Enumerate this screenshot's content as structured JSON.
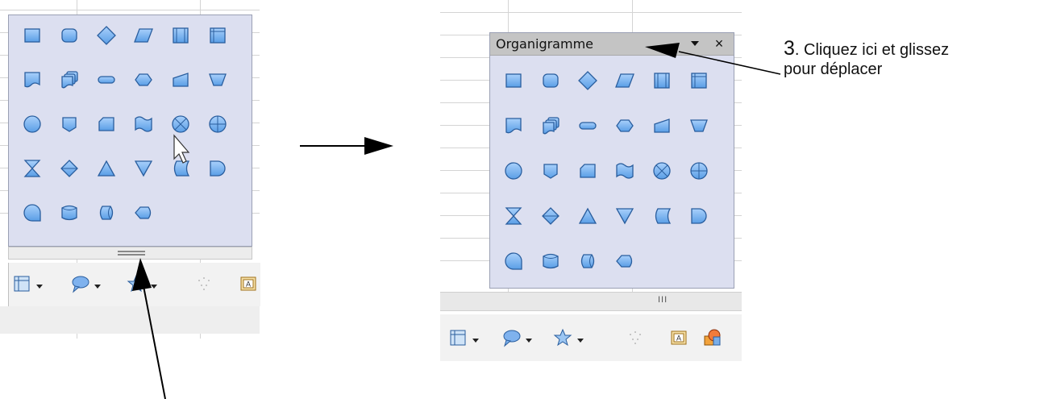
{
  "palette": {
    "title": "Organigramme",
    "close_glyph": "×",
    "menu_glyph": "▼",
    "shapes": [
      [
        "flowchart-process-icon",
        "flowchart-alternate-process-icon",
        "flowchart-decision-icon",
        "flowchart-data-icon",
        "flowchart-predefined-process-icon",
        "flowchart-internal-storage-icon"
      ],
      [
        "flowchart-document-icon",
        "flowchart-multidocument-icon",
        "flowchart-terminator-icon",
        "flowchart-preparation-icon",
        "flowchart-manual-input-icon",
        "flowchart-manual-operation-icon"
      ],
      [
        "flowchart-connector-icon",
        "flowchart-off-page-connector-icon",
        "flowchart-card-icon",
        "flowchart-punched-tape-icon",
        "flowchart-summing-junction-icon",
        "flowchart-or-icon"
      ],
      [
        "flowchart-collate-icon",
        "flowchart-sort-icon",
        "flowchart-extract-icon",
        "flowchart-merge-icon",
        "flowchart-stored-data-icon",
        "flowchart-delay-icon"
      ],
      [
        "flowchart-sequential-access-icon",
        "flowchart-magnetic-disc-icon",
        "flowchart-direct-access-storage-icon",
        "flowchart-display-icon"
      ]
    ]
  },
  "toolbar": {
    "items": [
      "flowchart-tool-icon",
      "callouts-tool-icon",
      "stars-tool-icon",
      "points-tool-icon",
      "text-box-tool-icon",
      "fontwork-tool-icon"
    ],
    "grip_glyph": "III"
  },
  "annotation": {
    "step_number": "3",
    "step_text": ". Cliquez ici et glissez",
    "step_text_line2": "pour déplacer"
  },
  "colors": {
    "shape_fill": "#5a9ee6",
    "shape_stroke": "#2a5e9e",
    "palette_bg": "#dcdff0",
    "titlebar_bg": "#c4c4c4"
  }
}
